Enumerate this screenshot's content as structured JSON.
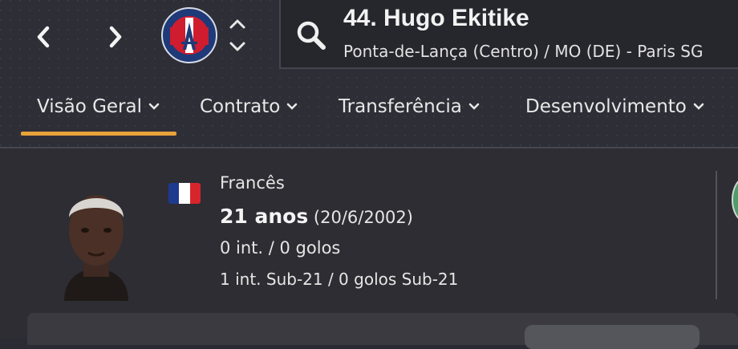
{
  "nav": {
    "back_icon": "chevron-left-icon",
    "forward_icon": "chevron-right-icon"
  },
  "club": {
    "logo_icon": "psg-crest-icon",
    "colors": {
      "navy": "#1e3a78",
      "red": "#d01c2f",
      "white": "#ffffff"
    }
  },
  "player": {
    "title": "44. Hugo Ekitike",
    "subtitle": "Ponta-de-Lança (Centro) / MO (DE) - Paris SG",
    "nationality": "Francês",
    "age": "21 anos",
    "birthdate": "(20/6/2002)",
    "caps": "0 int. / 0 golos",
    "u21_caps": "1 int. Sub-21 / 0 golos Sub-21",
    "flag_colors": [
      "#1e3a8f",
      "#ffffff",
      "#d8252c"
    ]
  },
  "tabs": [
    {
      "label": "Visão Geral",
      "active": true
    },
    {
      "label": "Contrato",
      "active": false
    },
    {
      "label": "Transferência",
      "active": false
    },
    {
      "label": "Desenvolvimento",
      "active": false
    }
  ],
  "theme": {
    "accent": "#e8a23a",
    "background": "#2b2b33"
  }
}
